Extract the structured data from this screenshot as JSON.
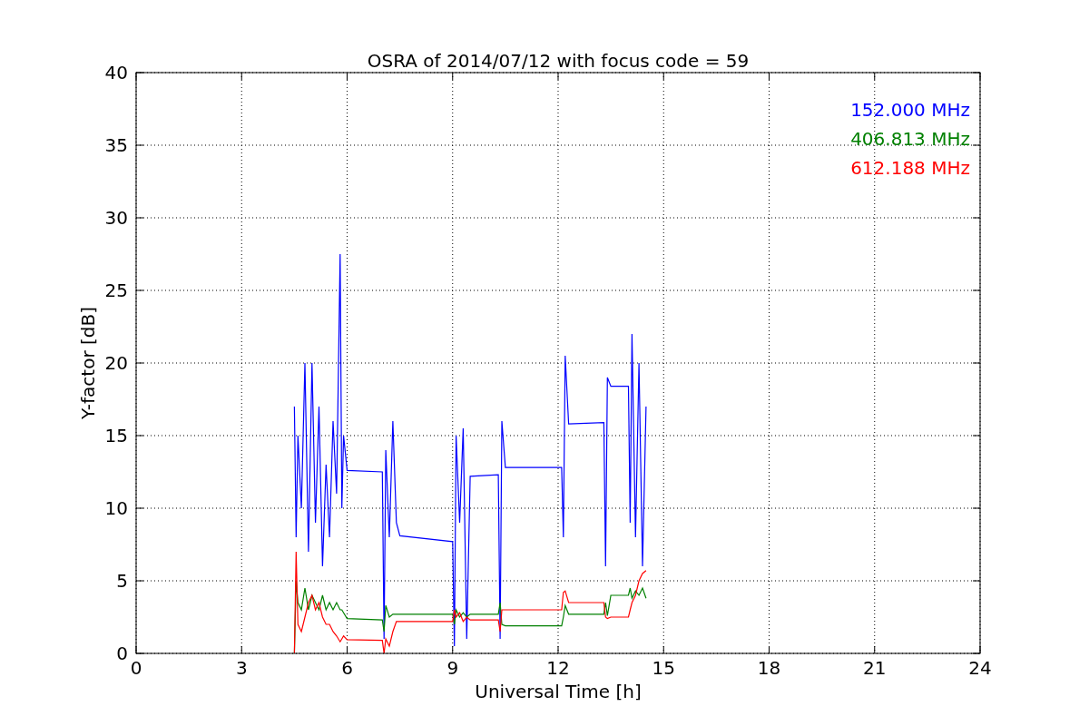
{
  "chart_data": {
    "type": "line",
    "title": "OSRA of 2014/07/12 with focus code = 59",
    "xlabel": "Universal Time [h]",
    "ylabel": "Y-factor [dB]",
    "xlim": [
      0,
      24
    ],
    "ylim": [
      0,
      40
    ],
    "xticks": [
      0,
      3,
      6,
      9,
      12,
      15,
      18,
      21,
      24
    ],
    "yticks": [
      0,
      5,
      10,
      15,
      20,
      25,
      30,
      35,
      40
    ],
    "grid": true,
    "x": [
      4.5,
      4.55,
      4.6,
      4.7,
      4.8,
      4.9,
      5.0,
      5.1,
      5.2,
      5.3,
      5.4,
      5.5,
      5.6,
      5.7,
      5.8,
      5.85,
      5.9,
      6.0,
      7.0,
      7.05,
      7.1,
      7.2,
      7.3,
      7.4,
      7.5,
      9.0,
      9.05,
      9.1,
      9.2,
      9.3,
      9.4,
      9.5,
      10.3,
      10.35,
      10.4,
      10.5,
      12.1,
      12.15,
      12.2,
      12.3,
      13.3,
      13.35,
      13.4,
      13.5,
      14.0,
      14.05,
      14.1,
      14.2,
      14.3,
      14.4,
      14.5
    ],
    "series": [
      {
        "name": "152.000 MHz",
        "color": "#0000ff",
        "values": [
          17,
          8,
          15,
          10,
          20,
          7,
          20,
          9,
          17,
          6,
          13,
          8,
          16,
          11,
          27.5,
          10,
          15,
          12.6,
          12.5,
          1,
          14,
          8,
          16,
          9,
          8.1,
          7.7,
          0.5,
          15,
          9,
          15.5,
          1,
          12.2,
          12.3,
          1,
          16,
          12.8,
          12.8,
          8,
          20.5,
          15.8,
          15.9,
          6,
          19,
          18.4,
          18.4,
          9,
          22,
          8,
          20,
          6,
          17
        ]
      },
      {
        "name": "406.813 MHz",
        "color": "#008000",
        "values": [
          0,
          5,
          3.5,
          3,
          4.5,
          3,
          4,
          3.5,
          3,
          4,
          3,
          3.5,
          3,
          3.5,
          3,
          3,
          2.8,
          2.4,
          2.3,
          1.5,
          3.3,
          2.5,
          2.7,
          2.7,
          2.7,
          2.7,
          2,
          3,
          2.5,
          2.8,
          2.5,
          2.7,
          2.7,
          3.5,
          2,
          1.9,
          1.9,
          2.5,
          3.3,
          2.7,
          2.7,
          3.5,
          2.6,
          4,
          4,
          4.5,
          3.8,
          4.3,
          4,
          4.5,
          3.8
        ]
      },
      {
        "name": "612.188 MHz",
        "color": "#ff0000",
        "values": [
          0,
          7,
          2,
          1.5,
          2.5,
          3.5,
          4,
          3,
          3.5,
          2.5,
          2,
          2,
          1.5,
          1.2,
          0.8,
          1,
          1.2,
          0.95,
          0.9,
          0,
          1,
          0.5,
          1.5,
          2.2,
          2.2,
          2.2,
          3,
          2.5,
          2.8,
          2.2,
          2.5,
          2.3,
          2.3,
          1.5,
          3,
          3,
          3,
          4.2,
          4.3,
          3.5,
          3.5,
          2.5,
          2.4,
          2.5,
          2.5,
          3,
          3.5,
          4,
          5,
          5.5,
          5.7
        ]
      }
    ]
  }
}
